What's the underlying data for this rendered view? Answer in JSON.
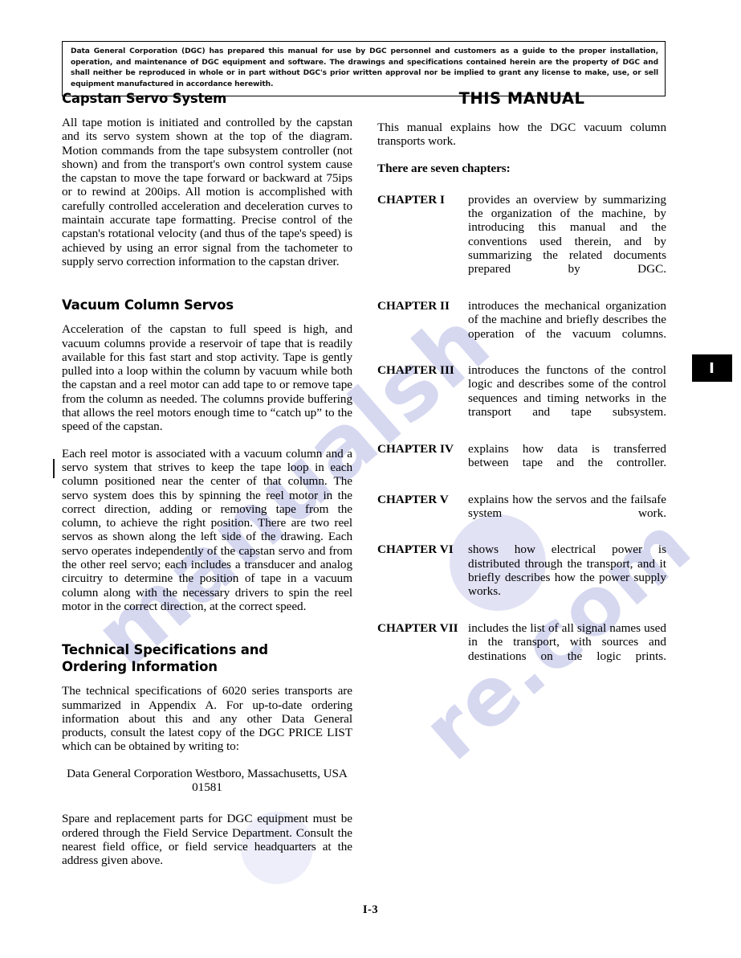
{
  "notice": {
    "text": "Data General Corporation (DGC) has prepared this manual for use by DGC personnel and customers as a guide to the proper installation, operation, and maintenance of DGC equipment and software. The drawings and specifications contained herein are the property of DGC and shall neither be reproduced in whole or in part without DGC's prior written approval nor be implied to grant any license to make, use, or sell equipment manufactured in accordance herewith."
  },
  "left_column": {
    "capstan": {
      "heading": "Capstan Servo System",
      "paragraph": "All tape motion is initiated and controlled by the capstan and its servo system shown at the top of the diagram. Motion commands from the tape subsystem controller (not shown) and from the transport's own control system cause the capstan to move the tape forward or backward at 75ips or to rewind at 200ips. All motion is accomplished with carefully controlled acceleration and deceleration curves to maintain accurate tape formatting. Precise control of the capstan's rotational velocity (and thus of the tape's speed) is achieved by using an error signal from the tachometer to supply servo correction information to the capstan driver."
    },
    "vacuum": {
      "heading": "Vacuum Column Servos",
      "paragraph1": "Acceleration of the capstan to full speed is high, and vacuum columns provide a reservoir of tape that is readily available for this fast start and stop activity. Tape is gently pulled into a loop within the column by vacuum while both the capstan and a reel motor can add tape to or remove tape from the column as needed. The columns provide buffering that allows the reel motors enough time to “catch up” to the speed of the capstan.",
      "paragraph2": "Each reel motor is associated with a vacuum column and a servo system that strives to keep the tape loop in each column positioned near the center of that column. The servo system does this by spinning the reel motor in the correct direction, adding or removing tape from the column, to achieve the right position. There are two reel servos as shown along the left side of the drawing. Each servo operates independently of the capstan servo and from the other reel servo; each includes a transducer and analog circuitry to determine the position of tape in a vacuum column along with the necessary drivers to spin the reel motor in the correct direction, at the correct speed."
    },
    "techspec": {
      "heading_line1": "Technical Specifications and",
      "heading_line2": "Ordering Information",
      "paragraph1": "The technical specifications of 6020 series transports are summarized in Appendix A. For up-to-date ordering information about this and any other Data General products, consult the latest copy of the DGC PRICE LIST which can be obtained by writing to:",
      "address": "Data General Corporation Westboro, Massachusetts, USA 01581",
      "paragraph2": "Spare and replacement parts for DGC equipment must be ordered through the Field Service Department. Consult the nearest field office, or field service headquarters at the address given above."
    }
  },
  "right_column": {
    "heading": "THIS MANUAL",
    "intro": "This manual explains how the DGC vacuum column transports work.",
    "chapters_lead": "There are seven chapters:",
    "chapters": [
      {
        "label": "CHAPTER I",
        "description": "provides an overview by summarizing the organization of the machine, by introducing this manual and the conventions used therein, and by summarizing the related documents prepared by DGC."
      },
      {
        "label": "CHAPTER II",
        "description": "introduces the mechanical organization of the machine and briefly describes the operation of the vacuum columns."
      },
      {
        "label": "CHAPTER III",
        "description": "introduces the functons of the control logic and describes some of the control sequences and timing networks in the transport and tape subsystem."
      },
      {
        "label": "CHAPTER IV",
        "description": "explains how data is transferred between tape and the controller."
      },
      {
        "label": "CHAPTER V",
        "description": "explains how the servos and the failsafe system work."
      },
      {
        "label": "CHAPTER VI",
        "description": "shows how electrical power is distributed through the transport, and it briefly describes how the power supply works."
      },
      {
        "label": "CHAPTER VII",
        "description": "includes the list of all signal names used in the transport, with sources and destinations on the logic prints."
      }
    ]
  },
  "edge_tab": {
    "label": "I"
  },
  "footer": {
    "page_number": "I-3"
  },
  "watermark": {
    "line1": "manualsh",
    "line2": "re.com",
    "color": "#9aa0dc"
  }
}
